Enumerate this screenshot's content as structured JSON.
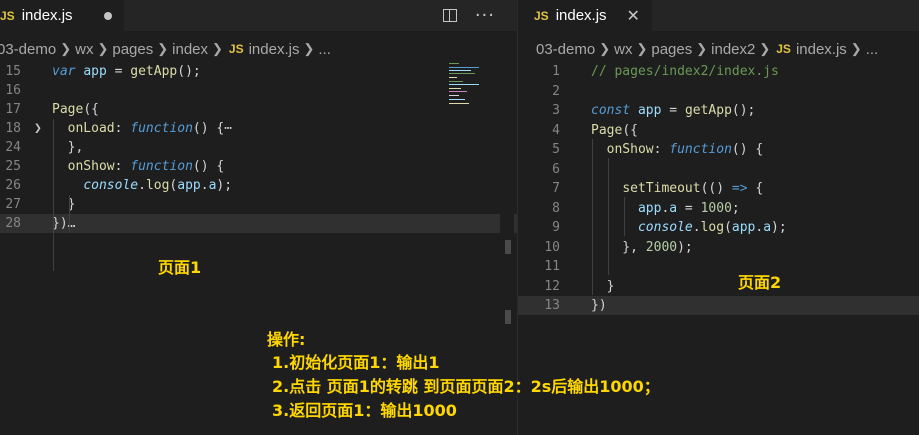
{
  "left_editor": {
    "tab": {
      "badge": "JS",
      "filename": "index.js"
    },
    "breadcrumb": [
      "03-demo",
      "wx",
      "pages",
      "index"
    ],
    "breadcrumb_file": "index.js",
    "breadcrumb_tail": "...",
    "lines": [
      {
        "num": "15",
        "html": "<span class='kw'>var</span> <span class='var'>app</span> = <span class='fn'>getApp</span>();"
      },
      {
        "num": "16",
        "html": ""
      },
      {
        "num": "17",
        "html": "<span class='fn'>Page</span>({"
      },
      {
        "num": "18",
        "html": "  <span class='fn'>onLoad</span>: <span class='kw'>function</span>() {⋯"
      },
      {
        "num": "24",
        "html": "  },"
      },
      {
        "num": "25",
        "html": "  <span class='fn'>onShow</span>: <span class='kw'>function</span>() {"
      },
      {
        "num": "26",
        "html": "    <span class='var ital'>console</span>.<span class='fn'>log</span>(<span class='var'>app</span>.<span class='var'>a</span>);"
      },
      {
        "num": "27",
        "html": "  }"
      },
      {
        "num": "28",
        "html": "})…"
      }
    ]
  },
  "right_editor": {
    "tab": {
      "badge": "JS",
      "filename": "index.js"
    },
    "breadcrumb": [
      "03-demo",
      "wx",
      "pages",
      "index2"
    ],
    "breadcrumb_file": "index.js",
    "breadcrumb_tail": "...",
    "lines": [
      {
        "num": "1",
        "html": "<span class='cmt'>// pages/index2/index.js</span>"
      },
      {
        "num": "2",
        "html": ""
      },
      {
        "num": "3",
        "html": "<span class='kw'>const</span> <span class='var'>app</span> = <span class='fn'>getApp</span>();"
      },
      {
        "num": "4",
        "html": "<span class='fn'>Page</span>({"
      },
      {
        "num": "5",
        "html": "  <span class='fn'>onShow</span>: <span class='kw'>function</span>() {"
      },
      {
        "num": "6",
        "html": ""
      },
      {
        "num": "7",
        "html": "    <span class='fn'>setTimeout</span>(() <span class='kw'>=></span> {"
      },
      {
        "num": "8",
        "html": "      <span class='var'>app</span>.<span class='var'>a</span> = <span class='num'>1000</span>;"
      },
      {
        "num": "9",
        "html": "      <span class='var ital'>console</span>.<span class='fn'>log</span>(<span class='var'>app</span>.<span class='var'>a</span>);"
      },
      {
        "num": "10",
        "html": "    }, <span class='num'>2000</span>);"
      },
      {
        "num": "11",
        "html": ""
      },
      {
        "num": "12",
        "html": "  }"
      },
      {
        "num": "13",
        "html": "})"
      }
    ]
  },
  "annotations": {
    "page1": "页面1",
    "page2": "页面2",
    "ops_title": "操作:",
    "op1": "1.初始化页面1：输出1",
    "op2": "2.点击 页面1的转跳  到页面页面2：2s后输出1000；",
    "op3": "3.返回页面1：输出1000"
  }
}
